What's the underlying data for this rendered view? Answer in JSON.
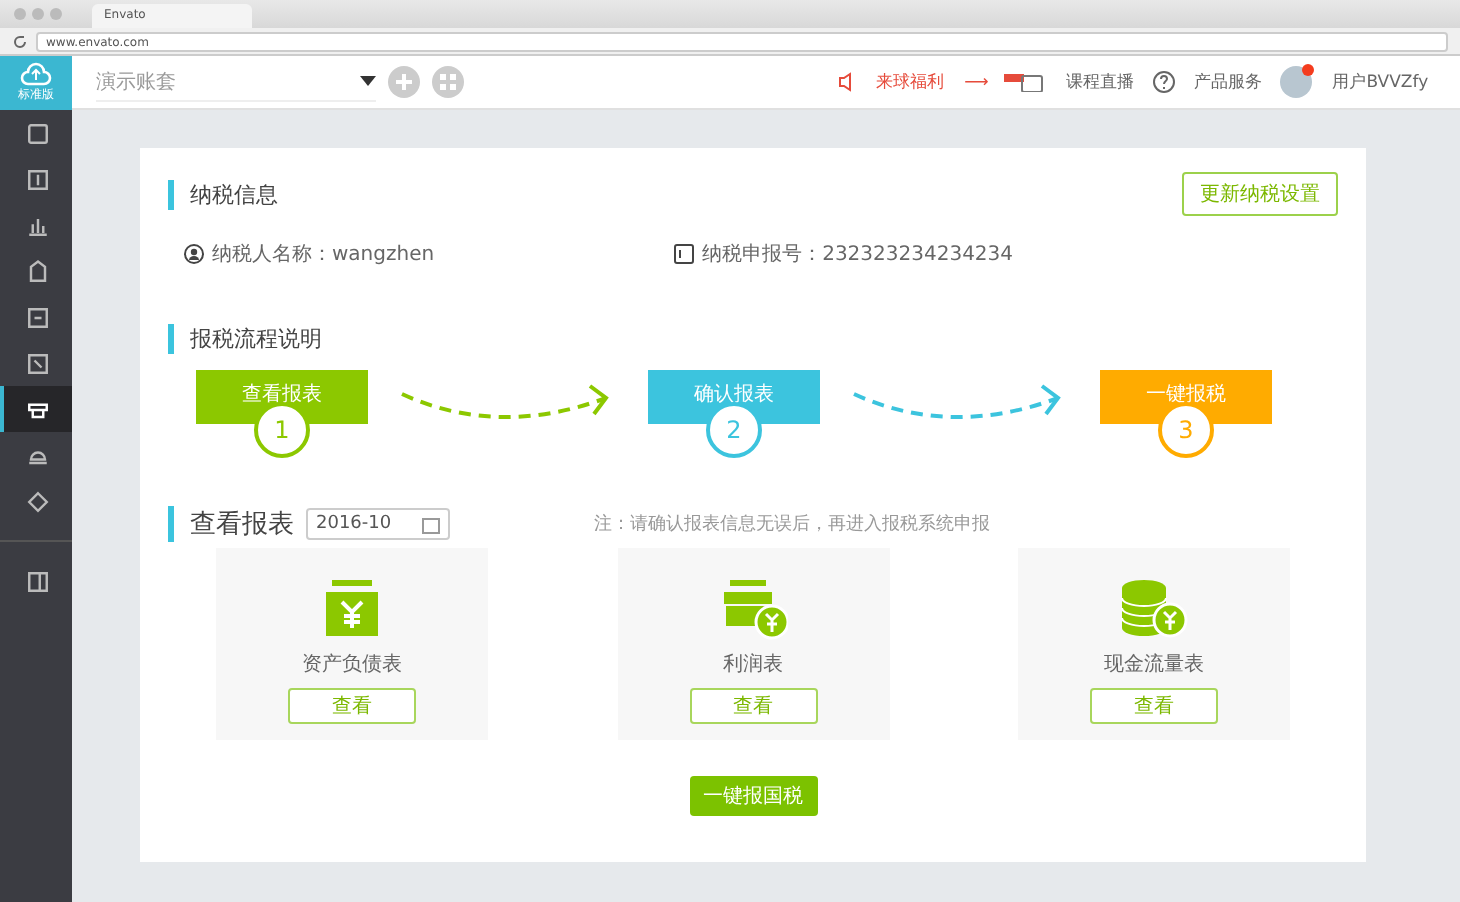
{
  "browser": {
    "tab_title": "Envato",
    "url": "www.envato.com"
  },
  "logo": {
    "label": "标准版"
  },
  "header": {
    "account_select": "演示账套",
    "promo": "来球福利",
    "promo_arrow": "⟶",
    "live": "课程直播",
    "service": "产品服务",
    "user": "用户BVVZfy",
    "user_notification": true
  },
  "sidebar": {
    "items": [
      {
        "selected": false
      },
      {
        "selected": false
      },
      {
        "selected": false
      },
      {
        "selected": false
      },
      {
        "selected": false
      },
      {
        "selected": false
      },
      {
        "selected": true
      },
      {
        "selected": false
      },
      {
        "selected": false
      }
    ]
  },
  "tax_info": {
    "title": "纳税信息",
    "update_button": "更新纳税设置",
    "taxpayer_name": "纳税人名称：wangzhen",
    "tax_number": "纳税申报号：232323234234234"
  },
  "process": {
    "title": "报税流程说明",
    "steps": [
      {
        "label": "查看报表",
        "number": "1",
        "color": "#8cc800"
      },
      {
        "label": "确认报表",
        "number": "2",
        "color": "#3cc4de"
      },
      {
        "label": "一键报税",
        "number": "3",
        "color": "#ffab00"
      }
    ]
  },
  "reports": {
    "title": "查看报表",
    "period": "2016-10",
    "note": "注：请确认报表信息无误后，再进入报税系统申报",
    "cards": [
      {
        "kind": "wallet",
        "name": "资产负债表",
        "button": "查看"
      },
      {
        "kind": "shop",
        "name": "利润表",
        "button": "查看"
      },
      {
        "kind": "coins",
        "name": "现金流量表",
        "button": "查看"
      }
    ],
    "submit_button": "一键报国税"
  }
}
